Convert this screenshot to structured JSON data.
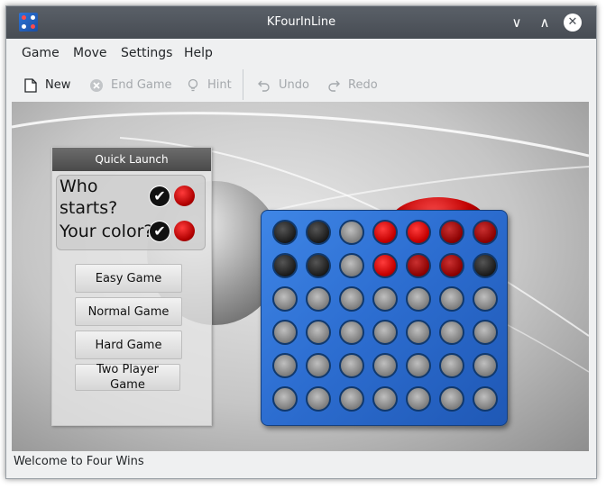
{
  "window": {
    "title": "KFourInLine"
  },
  "app_icon": "kfourinline-icon",
  "title_buttons": {
    "minimize": "∨",
    "maximize": "∧",
    "close": "✕"
  },
  "menu": [
    "Game",
    "Move",
    "Settings",
    "Help"
  ],
  "toolbar": {
    "new": {
      "label": "New",
      "icon": "new-document-icon"
    },
    "end_game": {
      "label": "End Game",
      "icon": "end-game-icon"
    },
    "hint": {
      "label": "Hint",
      "icon": "lightbulb-icon"
    },
    "undo": {
      "label": "Undo",
      "icon": "undo-icon"
    },
    "redo": {
      "label": "Redo",
      "icon": "redo-icon"
    }
  },
  "quick_launch": {
    "title": "Quick Launch",
    "who_starts": "Who starts?",
    "your_color": "Your color?",
    "buttons": [
      "Easy Game",
      "Normal Game",
      "Hard Game",
      "Two Player Game"
    ]
  },
  "board": {
    "rows": [
      [
        "black",
        "black",
        "empty",
        "red",
        "red",
        "darkred",
        "darkred"
      ],
      [
        "black",
        "black",
        "empty",
        "red",
        "darkred",
        "darkred",
        "black"
      ],
      [
        "empty",
        "empty",
        "empty",
        "empty",
        "empty",
        "empty",
        "empty"
      ],
      [
        "empty",
        "empty",
        "empty",
        "empty",
        "empty",
        "empty",
        "empty"
      ],
      [
        "empty",
        "empty",
        "empty",
        "empty",
        "empty",
        "empty",
        "empty"
      ],
      [
        "empty",
        "empty",
        "empty",
        "empty",
        "empty",
        "empty",
        "empty"
      ]
    ]
  },
  "status": "Welcome to Four Wins",
  "colors": {
    "accent": "#2d6ed1",
    "titlebar": "#474c53",
    "red": "#c50000"
  }
}
